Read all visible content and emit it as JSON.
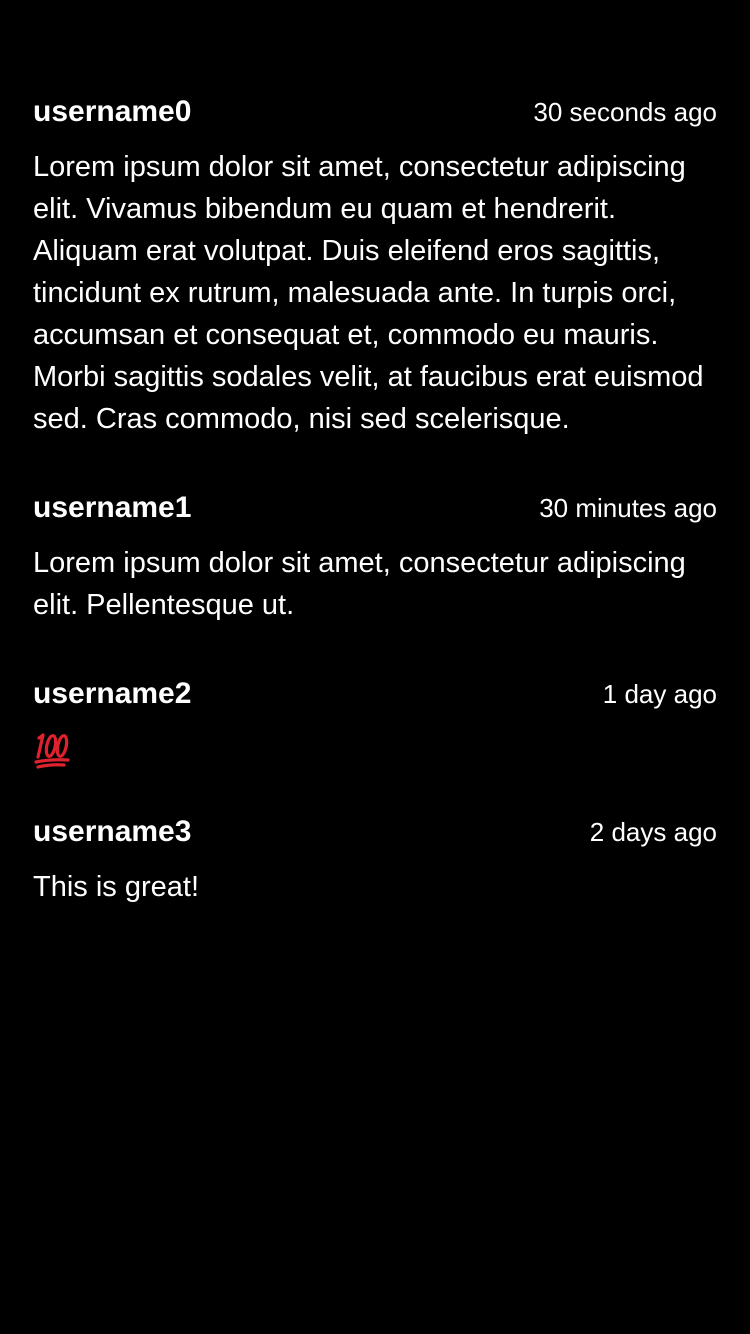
{
  "comments": [
    {
      "username": "username0",
      "time": "30 seconds ago",
      "text": "Lorem ipsum dolor sit amet, consectetur adipiscing elit. Vivamus bibendum eu quam et hendrerit. Aliquam erat volutpat. Duis eleifend eros sagittis, tincidunt ex rutrum, malesuada ante. In turpis orci, accumsan et consequat et, commodo eu mauris. Morbi sagittis sodales velit, at faucibus erat euismod sed. Cras commodo, nisi sed scelerisque."
    },
    {
      "username": "username1",
      "time": "30 minutes ago",
      "text": "Lorem ipsum dolor sit amet, consectetur adipiscing elit. Pellentesque ut."
    },
    {
      "username": "username2",
      "time": "1 day ago",
      "emoji": "hundred-points-icon"
    },
    {
      "username": "username3",
      "time": "2 days ago",
      "text": "This is great!"
    }
  ],
  "colors": {
    "background": "#000000",
    "text": "#ffffff",
    "emoji_red": "#e0212e"
  }
}
